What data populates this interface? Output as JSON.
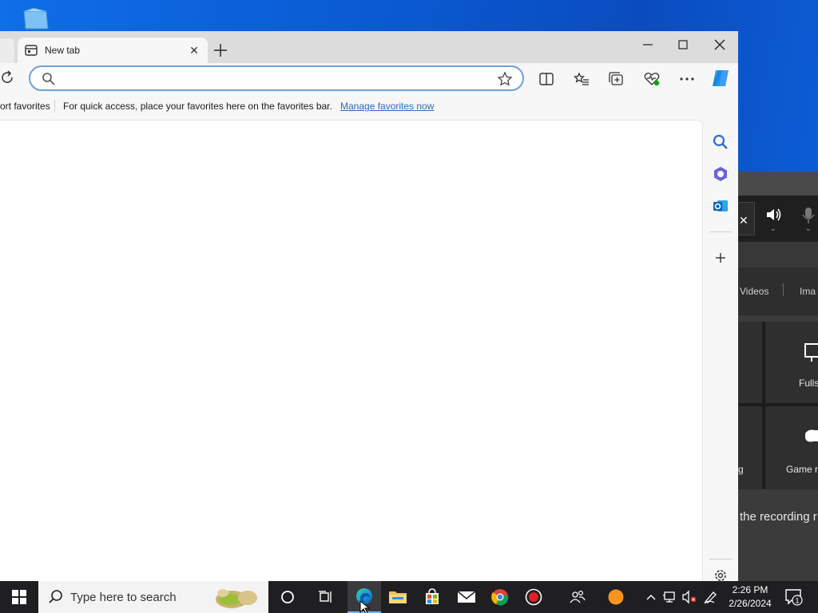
{
  "browser": {
    "tab": {
      "title": "New tab"
    },
    "address": {
      "value": "",
      "placeholder": ""
    },
    "favorites_bar": {
      "import_partial": "ort favorites",
      "message": "For quick access, place your favorites here on the favorites bar.",
      "manage_link": "Manage favorites now"
    }
  },
  "gamebar": {
    "tab_videos": "Videos",
    "tab_images_partial": "Ima",
    "tile_fullscreen_partial": "Fulls",
    "tile_game_partial": "Game re",
    "tile_left_partial": "g",
    "recording_text": "the recording r"
  },
  "taskbar": {
    "search_placeholder": "Type here to search",
    "clock_time": "2:26 PM",
    "clock_date": "2/26/2024",
    "notification_count": "1"
  },
  "colors": {
    "accent": "#0067c0",
    "link": "#2a6bb8",
    "taskbar_bg": "#1f1f22"
  },
  "icons": {
    "window": [
      "minimize-icon",
      "maximize-icon",
      "close-icon"
    ],
    "toolbar": [
      "split-screen-icon",
      "favorites-icon",
      "collections-icon",
      "browser-essentials-icon",
      "more-icon",
      "copilot-icon"
    ],
    "sidebar": [
      "search-icon",
      "copilot-app-icon",
      "outlook-icon",
      "add-icon",
      "settings-icon"
    ],
    "taskbar": [
      "windows-start-icon",
      "cortana-icon",
      "task-view-icon",
      "edge-icon",
      "file-explorer-icon",
      "store-icon",
      "mail-icon",
      "chrome-icon",
      "record-icon",
      "people-icon",
      "orange-app-icon"
    ]
  }
}
